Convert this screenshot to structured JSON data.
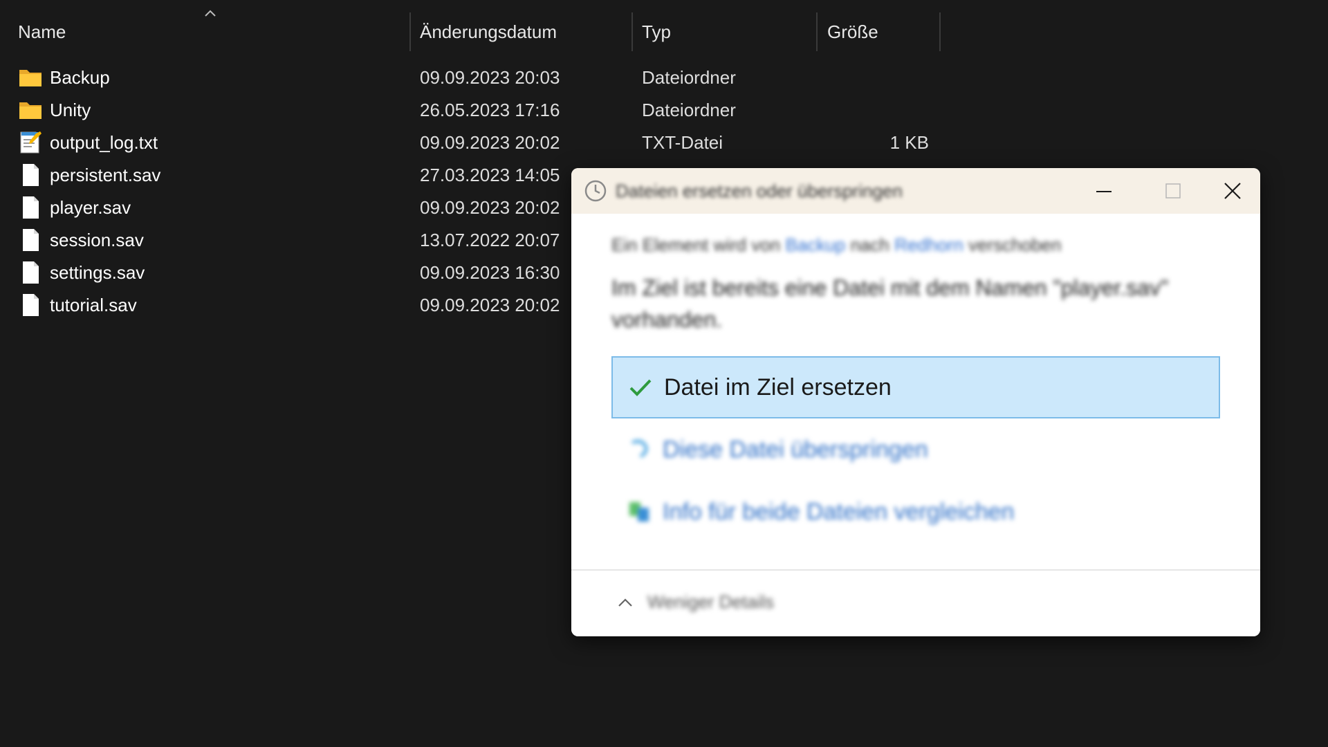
{
  "columns": {
    "name": "Name",
    "date": "Änderungsdatum",
    "type": "Typ",
    "size": "Größe"
  },
  "files": [
    {
      "name": "Backup",
      "date": "09.09.2023 20:03",
      "type": "Dateiordner",
      "size": "",
      "icon": "folder-icon"
    },
    {
      "name": "Unity",
      "date": "26.05.2023 17:16",
      "type": "Dateiordner",
      "size": "",
      "icon": "folder-icon"
    },
    {
      "name": "output_log.txt",
      "date": "09.09.2023 20:02",
      "type": "TXT-Datei",
      "size": "1 KB",
      "icon": "text-file-icon"
    },
    {
      "name": "persistent.sav",
      "date": "27.03.2023 14:05",
      "type": "",
      "size": "",
      "icon": "file-icon"
    },
    {
      "name": "player.sav",
      "date": "09.09.2023 20:02",
      "type": "",
      "size": "",
      "icon": "file-icon"
    },
    {
      "name": "session.sav",
      "date": "13.07.2022 20:07",
      "type": "",
      "size": "",
      "icon": "file-icon"
    },
    {
      "name": "settings.sav",
      "date": "09.09.2023 16:30",
      "type": "",
      "size": "",
      "icon": "file-icon"
    },
    {
      "name": "tutorial.sav",
      "date": "09.09.2023 20:02",
      "type": "",
      "size": "",
      "icon": "file-icon"
    }
  ],
  "dialog": {
    "title": "Dateien ersetzen oder überspringen",
    "subtitle_prefix": "Ein Element wird von",
    "subtitle_source": "Backup",
    "subtitle_mid": "nach",
    "subtitle_target": "Redhorn",
    "subtitle_suffix": "verschoben",
    "message": "Im Ziel ist bereits eine Datei mit dem Namen \"player.sav\" vorhanden.",
    "options": {
      "replace": "Datei im Ziel ersetzen",
      "skip": "Diese Datei überspringen",
      "compare": "Info für beide Dateien vergleichen"
    },
    "details_toggle": "Weniger Details"
  },
  "colors": {
    "background": "#191919",
    "dialog_title_bg": "#f6f0e6",
    "selected_option_bg": "#cce8fb",
    "link": "#2f6fd0",
    "checkmark": "#2e9b3e"
  }
}
